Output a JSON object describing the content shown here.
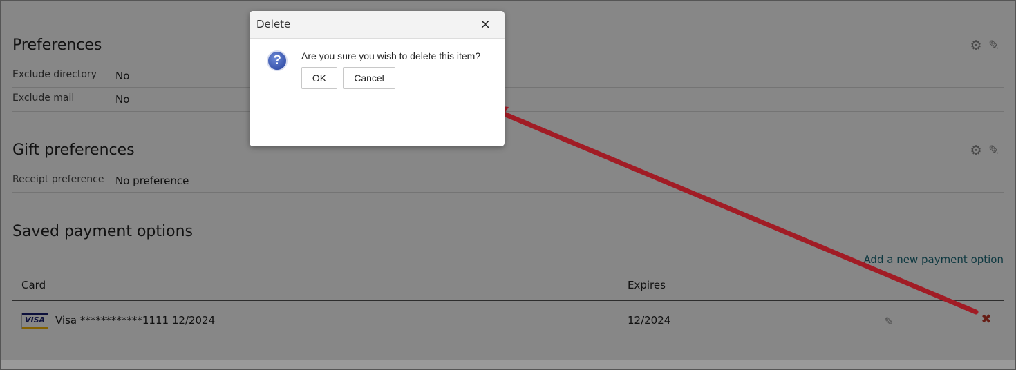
{
  "preferences": {
    "title": "Preferences",
    "rows": [
      {
        "label": "Exclude directory",
        "value": "No"
      },
      {
        "label": "Exclude mail",
        "value": "No"
      }
    ]
  },
  "gift_preferences": {
    "title": "Gift preferences",
    "rows": [
      {
        "label": "Receipt preference",
        "value": "No preference"
      }
    ]
  },
  "payments": {
    "title": "Saved payment options",
    "add_link": "Add a new payment option",
    "columns": {
      "card": "Card",
      "expires": "Expires"
    },
    "rows": [
      {
        "brand": "VISA",
        "card": "Visa ************1111 12/2024",
        "expires": "12/2024"
      }
    ]
  },
  "dialog": {
    "title": "Delete",
    "close": "×",
    "icon": "?",
    "message": "Are you sure you wish to delete this item?",
    "ok": "OK",
    "cancel": "Cancel"
  },
  "icons": {
    "settings": "gear-icon",
    "edit": "pencil-icon",
    "delete": "delete-x-icon",
    "help": "question-icon"
  },
  "colors": {
    "link": "#1d6c7c",
    "delete": "#c0392b",
    "annotation_arrow": "#a11c25",
    "overlay": "rgba(0,0,0,0.47)"
  }
}
